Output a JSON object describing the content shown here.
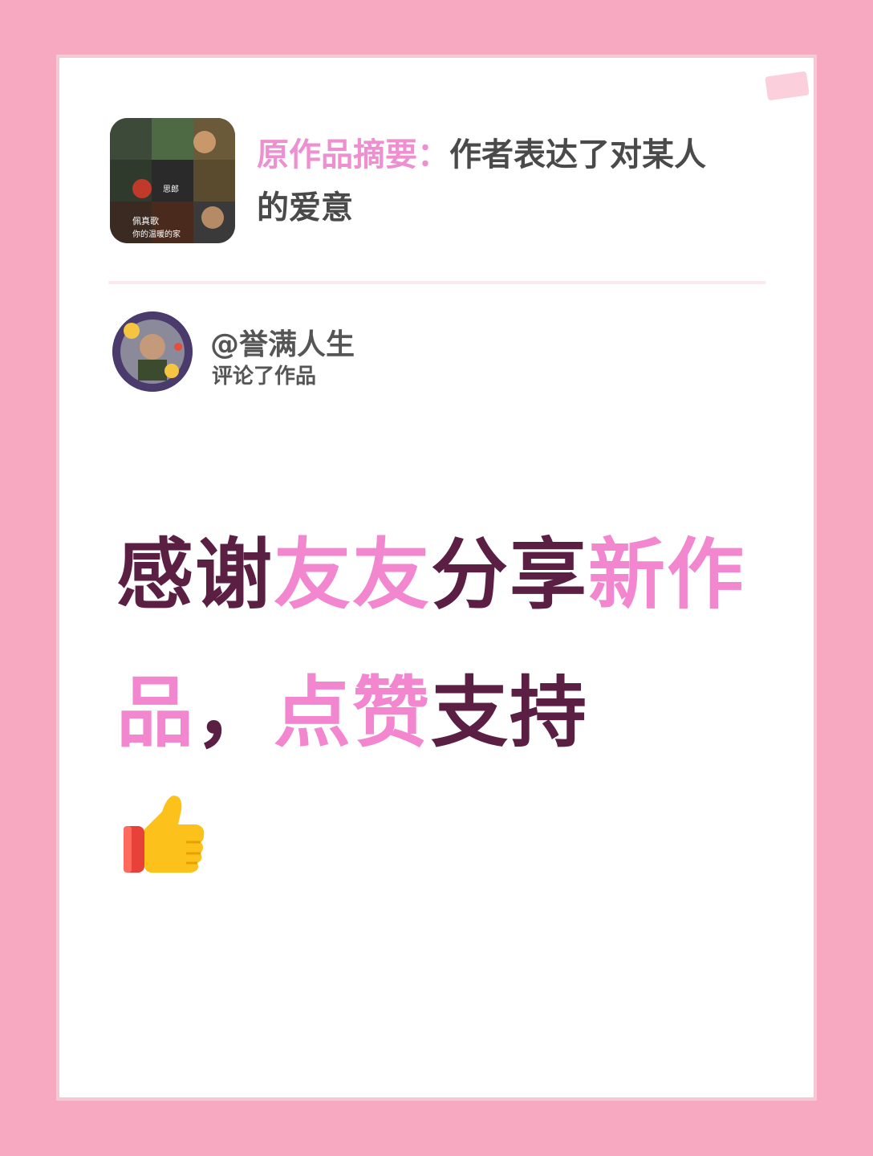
{
  "summary": {
    "label": "原作品摘要：",
    "text_line1": "作者表达了对某人",
    "text_line2": "的爱意"
  },
  "thumbnail": {
    "caption_top": "思郎",
    "caption_bottom_1": "佩真歌",
    "caption_bottom_2": "你的温暖的家"
  },
  "user": {
    "username": "@誉满人生",
    "action": "评论了作品"
  },
  "message": {
    "seg1": "感谢",
    "seg2": "友友",
    "seg3": "分享",
    "seg4": "新",
    "seg5": "作品",
    "seg6": "，",
    "seg7": "点赞",
    "seg8": "支持"
  },
  "icons": {
    "thumbs_up": "thumbs-up-icon"
  },
  "colors": {
    "background": "#f6a9c0",
    "accent_pink": "#f286cf",
    "text_dark": "#5a1f43"
  }
}
